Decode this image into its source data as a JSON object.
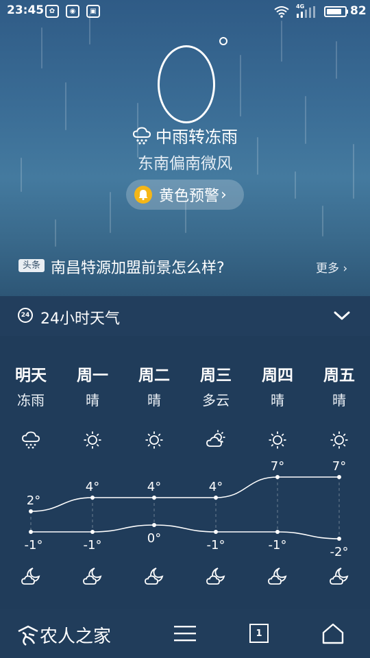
{
  "status_bar": {
    "time": "23:45",
    "battery": "82",
    "battery_level": 0.82,
    "network": "4G"
  },
  "current": {
    "temperature": "0",
    "degree_symbol": "°",
    "condition": "中雨转冻雨",
    "wind": "东南偏南微风",
    "warning_label": "黄色预警",
    "warning_color": "#f5b617"
  },
  "news": {
    "tag": "头条",
    "title": "南昌特源加盟前景怎么样?",
    "more": "更多"
  },
  "hourly_section": {
    "icon_text": "24",
    "title": "24小时天气"
  },
  "forecast": [
    {
      "day": "明天",
      "cond": "冻雨",
      "day_icon": "rain-cloud-icon",
      "night_icon": "moon-cloud-icon",
      "high": "2°",
      "low": "-1°"
    },
    {
      "day": "周一",
      "cond": "晴",
      "day_icon": "sun-icon",
      "night_icon": "moon-cloud-icon",
      "high": "4°",
      "low": "-1°"
    },
    {
      "day": "周二",
      "cond": "晴",
      "day_icon": "sun-icon",
      "night_icon": "moon-cloud-icon",
      "high": "4°",
      "low": "0°"
    },
    {
      "day": "周三",
      "cond": "多云",
      "day_icon": "sun-cloud-icon",
      "night_icon": "moon-cloud-icon",
      "high": "4°",
      "low": "-1°"
    },
    {
      "day": "周四",
      "cond": "晴",
      "day_icon": "sun-icon",
      "night_icon": "moon-cloud-icon",
      "high": "7°",
      "low": "-1°"
    },
    {
      "day": "周五",
      "cond": "晴",
      "day_icon": "sun-icon",
      "night_icon": "moon-cloud-icon",
      "high": "7°",
      "low": "-2°"
    }
  ],
  "chart_data": {
    "type": "line",
    "categories": [
      "明天",
      "周一",
      "周二",
      "周三",
      "周四",
      "周五"
    ],
    "series": [
      {
        "values": [
          2,
          4,
          4,
          4,
          7,
          7
        ]
      },
      {
        "values": [
          -1,
          -1,
          0,
          -1,
          -1,
          -2
        ]
      }
    ],
    "grid": false
  },
  "bottom_nav": {
    "logo_text": "农人之家",
    "tab_count": "1"
  }
}
